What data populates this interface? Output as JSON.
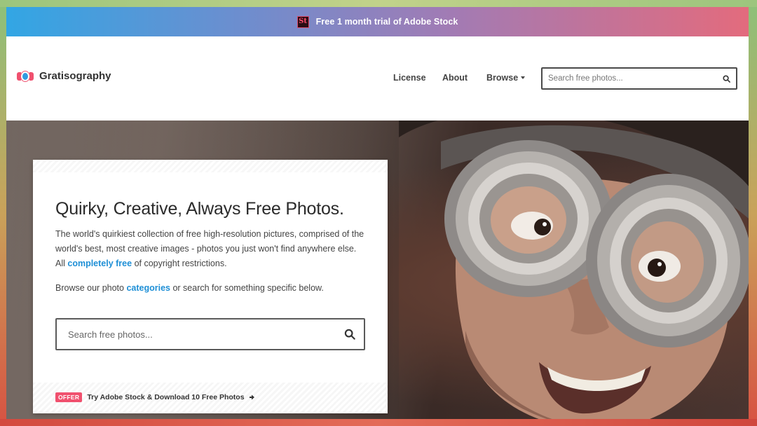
{
  "promo": {
    "logo_text": "St",
    "text": "Free 1 month trial of Adobe Stock"
  },
  "header": {
    "brand_name": "Gratisography",
    "nav": {
      "license": "License",
      "about": "About",
      "browse": "Browse"
    },
    "search_placeholder": "Search free photos..."
  },
  "hero": {
    "title": "Quirky, Creative, Always Free Photos.",
    "desc_part1": "The world's quirkiest collection of free high-resolution pictures, comprised of the world's best, most creative images - photos you just won't find anywhere else. All ",
    "desc_link": "completely free",
    "desc_part2": " of copyright restrictions.",
    "browse_part1": "Browse our photo ",
    "browse_link": "categories",
    "browse_part2": " or search for something specific below.",
    "search_placeholder": "Search free photos...",
    "offer_badge": "OFFER",
    "offer_text": "Try Adobe Stock & Download 10 Free Photos"
  },
  "colors": {
    "accent_link": "#1e8fd6",
    "offer_badge": "#f0506e",
    "promo_gradient_start": "#32a6e4",
    "promo_gradient_end": "#e36b7d"
  },
  "icons": {
    "search": "search-icon",
    "caret": "chevron-down-icon",
    "arrow": "arrow-right-icon",
    "brand": "gratisography-logo-icon",
    "adobe_stock": "adobe-stock-logo-icon"
  }
}
